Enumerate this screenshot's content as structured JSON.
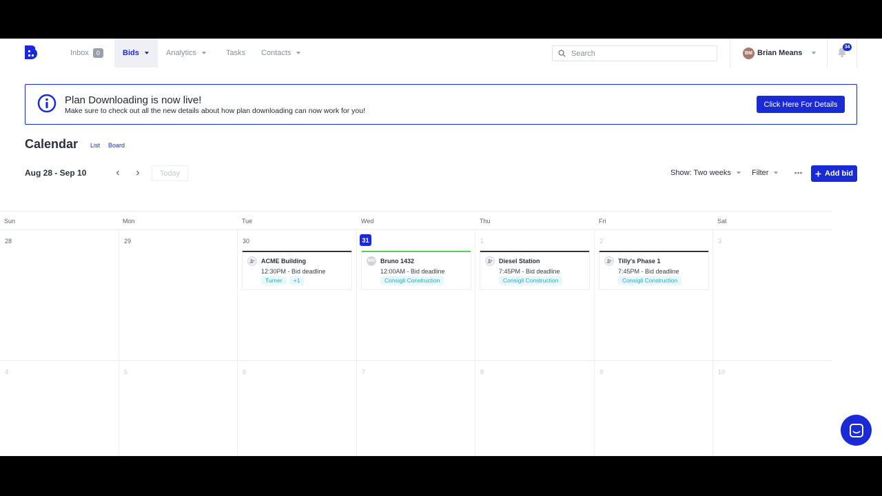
{
  "nav": {
    "items": [
      {
        "label": "Inbox",
        "badge": "0"
      },
      {
        "label": "Bids"
      },
      {
        "label": "Analytics"
      },
      {
        "label": "Tasks"
      },
      {
        "label": "Contacts"
      }
    ],
    "search_placeholder": "Search",
    "user": {
      "initials": "BM",
      "name": "Brian Means"
    },
    "notifications_count": "34"
  },
  "banner": {
    "title": "Plan Downloading is now live!",
    "text": "Make sure to check out all the new details about how plan downloading can now work for you!",
    "button": "Click Here For Details"
  },
  "calendar": {
    "title": "Calendar",
    "views": [
      "List",
      "Board"
    ],
    "range": "Aug 28 - Sep 10",
    "today_label": "Today",
    "show_label": "Show: Two weeks",
    "filter_label": "Filter",
    "add_label": "Add bid",
    "weekdays": [
      "Sun",
      "Mon",
      "Tue",
      "Wed",
      "Thu",
      "Fri",
      "Sat"
    ],
    "weeks": [
      [
        "28",
        "29",
        "30",
        "31",
        "1",
        "2",
        "3"
      ],
      [
        "4",
        "5",
        "6",
        "7",
        "8",
        "9",
        "10"
      ]
    ],
    "events": [
      {
        "title": "ACME Building",
        "time": "12:30PM - Bid deadline",
        "tags": [
          "Turner",
          "+1"
        ]
      },
      {
        "title": "Bruno 1432",
        "time": "12:00AM - Bid deadline",
        "tags": [
          "Consigli Construction"
        ],
        "initials": "MW"
      },
      {
        "title": "Diesel Station",
        "time": "7:45PM - Bid deadline",
        "tags": [
          "Consigli Construction"
        ]
      },
      {
        "title": "Tilly's Phase 1",
        "time": "7:45PM - Bid deadline",
        "tags": [
          "Consigli Construction"
        ]
      }
    ]
  },
  "colors": {
    "accent": "#1a2bd6",
    "tag_text": "#19b3c9",
    "tag_bg": "#e7f8fb"
  }
}
